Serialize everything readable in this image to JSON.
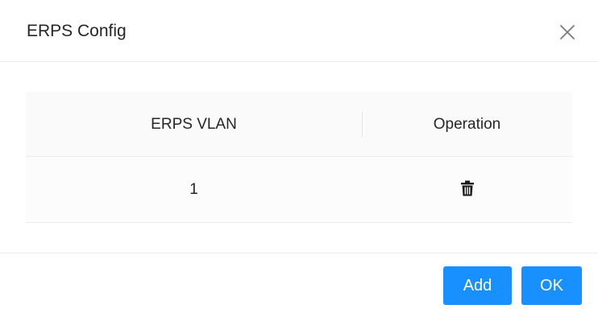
{
  "dialog": {
    "title": "ERPS Config",
    "close_icon": "close-icon"
  },
  "table": {
    "columns": [
      "ERPS VLAN",
      "Operation"
    ],
    "rows": [
      {
        "erps_vlan": "1",
        "operation_icon": "trash-icon"
      }
    ]
  },
  "footer": {
    "add_label": "Add",
    "ok_label": "OK"
  },
  "colors": {
    "primary": "#1890ff",
    "header_bg": "#fafafa",
    "border": "#ececec"
  }
}
